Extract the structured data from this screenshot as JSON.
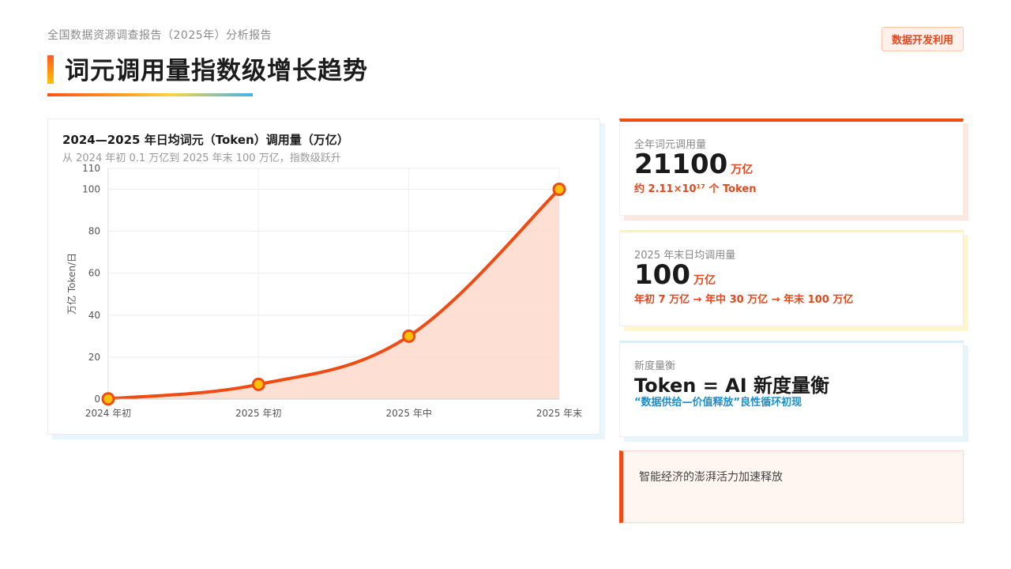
{
  "header": {
    "breadcrumb": "全国数据资源调查报告（2025年）分析报告",
    "tag": "数据开发利用",
    "title": "词元调用量指数级增长趋势"
  },
  "chart_card": {
    "title": "2024—2025 年日均词元（Token）调用量（万亿）",
    "subtitle": "从 2024 年初 0.1 万亿到 2025 年末 100 万亿，指数级跃升"
  },
  "chart_data": {
    "type": "area",
    "categories": [
      "2024 年初",
      "2025 年初",
      "2025 年中",
      "2025 年末"
    ],
    "values": [
      0.1,
      7,
      30,
      100
    ],
    "ylabel": "万亿 Token/日",
    "ylim": [
      0,
      110
    ],
    "yticks": [
      0,
      20,
      40,
      60,
      80,
      100,
      110
    ],
    "grid": true,
    "colors": {
      "line": "#f04b12",
      "fill": "#fdd9cc",
      "marker_fill": "#ffc107",
      "marker_stroke": "#f04b12"
    }
  },
  "stats": [
    {
      "label": "全年词元调用量",
      "value": "21100",
      "unit": "万亿",
      "note": "约 2.11×10¹⁷ 个 Token"
    },
    {
      "label": "2025 年末日均调用量",
      "value": "100",
      "unit": "万亿",
      "note": "年初 7 万亿 → 年中 30 万亿 → 年末 100 万亿"
    },
    {
      "label": "新度量衡",
      "value": "Token = AI 新度量衡",
      "note": "“数据供给—价值释放”良性循环初现"
    }
  ],
  "highlight": {
    "text": "智能经济的澎湃活力加速释放"
  }
}
